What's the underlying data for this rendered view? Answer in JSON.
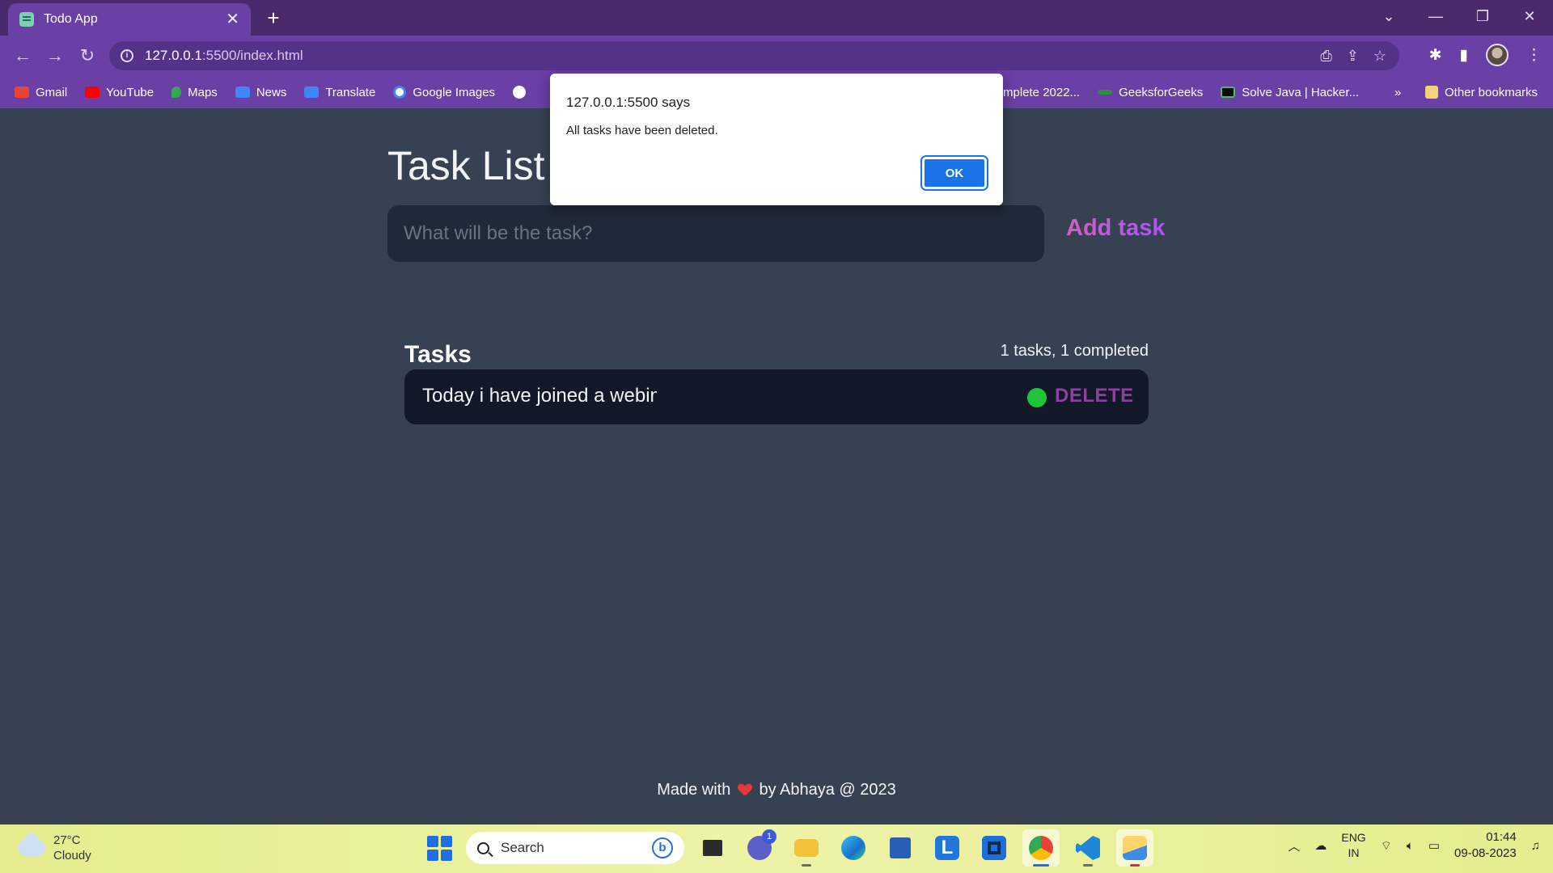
{
  "browser": {
    "tab_title": "Todo App",
    "tab_close": "✕",
    "new_tab": "+",
    "url_host": "127.0.0.1",
    "url_path": ":5500/index.html",
    "bookmarks": [
      {
        "label": "Gmail",
        "icon": "gmail-icon",
        "color": "#ea4335"
      },
      {
        "label": "YouTube",
        "icon": "youtube-icon",
        "color": "#ff0000"
      },
      {
        "label": "Maps",
        "icon": "maps-icon",
        "color": "#34a853"
      },
      {
        "label": "News",
        "icon": "news-icon",
        "color": "#4285f4"
      },
      {
        "label": "Translate",
        "icon": "translate-icon",
        "color": "#4285f4"
      },
      {
        "label": "Google Images",
        "icon": "google-icon",
        "color": "#ffffff"
      }
    ],
    "bookmarks_right": [
      {
        "label": "mplete 2022...",
        "icon": "bookmark-icon"
      },
      {
        "label": "GeeksforGeeks",
        "icon": "geeksforgeeks-icon"
      },
      {
        "label": "Solve Java | Hacker...",
        "icon": "hackerrank-icon"
      }
    ],
    "overflow": "»",
    "other_bookmarks": "Other bookmarks"
  },
  "app": {
    "title": "Task List",
    "input_placeholder": "What will be the task?",
    "add_button": "Add task",
    "tasks_heading": "Tasks",
    "tasks_count": "1 tasks, 1 completed",
    "tasks": [
      {
        "text": "Today i have joined a webin",
        "delete_label": "DELETE",
        "completed": true
      }
    ],
    "footer_prefix": "Made with",
    "footer_suffix": "by Abhaya @ 2023"
  },
  "dialog": {
    "title": "127.0.0.1:5500 says",
    "message": "All tasks have been deleted.",
    "ok": "OK"
  },
  "taskbar": {
    "temperature": "27°C",
    "weather": "Cloudy",
    "search_label": "Search",
    "teams_badge": "1",
    "lang_line1": "ENG",
    "lang_line2": "IN",
    "time": "01:44",
    "date": "09-08-2023"
  },
  "colors": {
    "page_bg": "#364152",
    "input_bg": "#1f2937",
    "task_bg": "#111827",
    "accent": "#c957b8",
    "check_green": "#1fc43a",
    "browser_purple": "#6a3fa6"
  }
}
